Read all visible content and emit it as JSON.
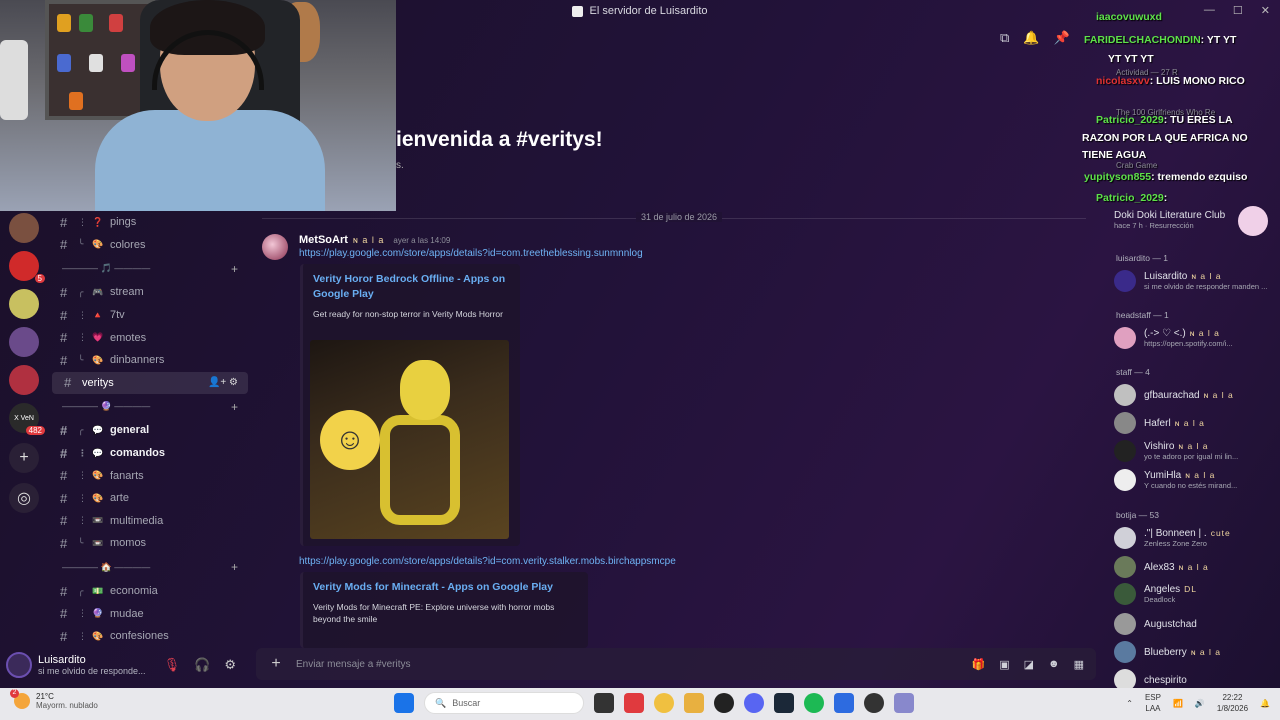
{
  "window": {
    "title": "El servidor de Luisardito"
  },
  "welcome": {
    "title": "ienvenida a #veritys!",
    "subtitle": "s."
  },
  "rail": {
    "badges": [
      "5",
      "482"
    ],
    "vn_label": "X VeN"
  },
  "channels": [
    {
      "name": "pings",
      "emoji": "❓",
      "tree": "⋮"
    },
    {
      "name": "colores",
      "emoji": "🎨",
      "tree": "╰"
    },
    {
      "category": true,
      "label": "———— 🎵 ————"
    },
    {
      "name": "stream",
      "emoji": "🎮",
      "tree": "╭"
    },
    {
      "name": "7tv",
      "emoji": "🔺",
      "tree": "⋮"
    },
    {
      "name": "emotes",
      "emoji": "💗",
      "tree": "⋮"
    },
    {
      "name": "dinbanners",
      "emoji": "🎨",
      "tree": "╰"
    },
    {
      "name": "veritys",
      "active": true
    },
    {
      "category": true,
      "label": "———— 🔮 ————"
    },
    {
      "name": "general",
      "emoji": "💬",
      "tree": "╭",
      "bold": true
    },
    {
      "name": "comandos",
      "emoji": "💬",
      "tree": "⋮",
      "bold": true
    },
    {
      "name": "fanarts",
      "emoji": "🎨",
      "tree": "⋮"
    },
    {
      "name": "arte",
      "emoji": "🎨",
      "tree": "⋮"
    },
    {
      "name": "multimedia",
      "emoji": "📼",
      "tree": "⋮"
    },
    {
      "name": "momos",
      "emoji": "📼",
      "tree": "╰"
    },
    {
      "category": true,
      "label": "———— 🏠 ————"
    },
    {
      "name": "economia",
      "emoji": "💵",
      "tree": "╭"
    },
    {
      "name": "mudae",
      "emoji": "🔮",
      "tree": "⋮"
    },
    {
      "name": "confesiones",
      "emoji": "🎨",
      "tree": "⋮"
    }
  ],
  "user": {
    "name": "Luisardito",
    "status": "si me olvido de responde..."
  },
  "date_divider": "31 de julio de 2026",
  "message": {
    "author": "MetSoArt",
    "tag": "ɴ a l a",
    "time": "ayer a las 14:09",
    "link1": "https://play.google.com/store/apps/details?id=com.treetheblessing.sunmnnlog",
    "embed1_title": "Verity Horor Bedrock Offline - Apps on Google Play",
    "embed1_desc": "Get ready for non-stop terror in Verity Mods Horror",
    "link2": "https://play.google.com/store/apps/details?id=com.verity.stalker.mobs.birchappsmcpe",
    "embed2_title": "Verity Mods for Minecraft - Apps on Google Play",
    "embed2_desc": "Verity Mods for Minecraft PE: Explore universe with horror mobs beyond the smile"
  },
  "composer": {
    "placeholder": "Enviar mensaje a #veritys"
  },
  "chat_overlay": [
    {
      "user": "iaacovuwuxd",
      "text": "",
      "color": "#5ee14a"
    },
    {
      "user": "FARIDELCHACHONDIN",
      "text": ": YT  YT",
      "color": "#5ee14a"
    },
    {
      "user": "",
      "text": "YT  YT  YT",
      "color": "#ffffff"
    },
    {
      "user": "nicolasxvv",
      "text": ": LUIS MONO RICO",
      "color": "#e03232"
    },
    {
      "user": "Patricio_2029",
      "text": ": TU ERES LA",
      "color": "#5ee14a"
    },
    {
      "user": "",
      "text": "RAZON POR LA QUE AFRICA NO",
      "color": "#ffffff"
    },
    {
      "user": "",
      "text": "TIENE AGUA",
      "color": "#ffffff"
    },
    {
      "user": "yupityson855",
      "text": ": tremendo ezquiso",
      "color": "#5ee14a"
    },
    {
      "user": "Patricio_2029",
      "text": ":",
      "color": "#5ee14a"
    }
  ],
  "chat_under": {
    "activity": "Actividad — 27 R",
    "book": "The 100 Girlfriends Who Re",
    "crab": "Crab Game"
  },
  "members": {
    "activity": {
      "name": "Doki Doki Literature Club",
      "sub": "hace 7 h · Resurrección"
    },
    "groups": [
      {
        "label": "luisardito — 1"
      },
      {
        "label": "headstaff — 1"
      },
      {
        "label": "staff — 4"
      },
      {
        "label": "botija — 53"
      }
    ],
    "list": [
      {
        "name": "Luisardito",
        "tag": "ɴ a l a",
        "sub": "si me olvido de responder manden ..."
      },
      {
        "name": "(.-> ♡ <.)",
        "tag": "ɴ a l a",
        "sub": "https://open.spotify.com/i..."
      },
      {
        "name": "gfbaurachad",
        "tag": "ɴ a l a",
        "sub": ""
      },
      {
        "name": "Haferl",
        "tag": "ɴ a l a",
        "sub": ""
      },
      {
        "name": "Vishiro",
        "tag": "ɴ a l a",
        "sub": "yo te adoro por igual mi lin..."
      },
      {
        "name": "YumiHla",
        "tag": "ɴ a l a",
        "sub": "Y cuando no estés mirand..."
      },
      {
        "name": ".\"| Bonneen | .",
        "tag": "cute",
        "sub": "Zenless Zone Zero"
      },
      {
        "name": "Alex83",
        "tag": "ɴ a l a",
        "sub": ""
      },
      {
        "name": "Angeles",
        "tag": "DL",
        "sub": "Deadlock"
      },
      {
        "name": "Augustchad",
        "tag": "",
        "sub": ""
      },
      {
        "name": "Blueberry",
        "tag": "ɴ a l a",
        "sub": ""
      },
      {
        "name": "chespirito",
        "tag": "",
        "sub": ""
      }
    ]
  },
  "taskbar": {
    "weather_temp": "21°C",
    "weather_desc": "Mayorm. nublado",
    "weather_badge": "2",
    "search": "Buscar",
    "lang1": "ESP",
    "lang2": "LAA",
    "time": "22:22",
    "date": "1/8/2026"
  }
}
